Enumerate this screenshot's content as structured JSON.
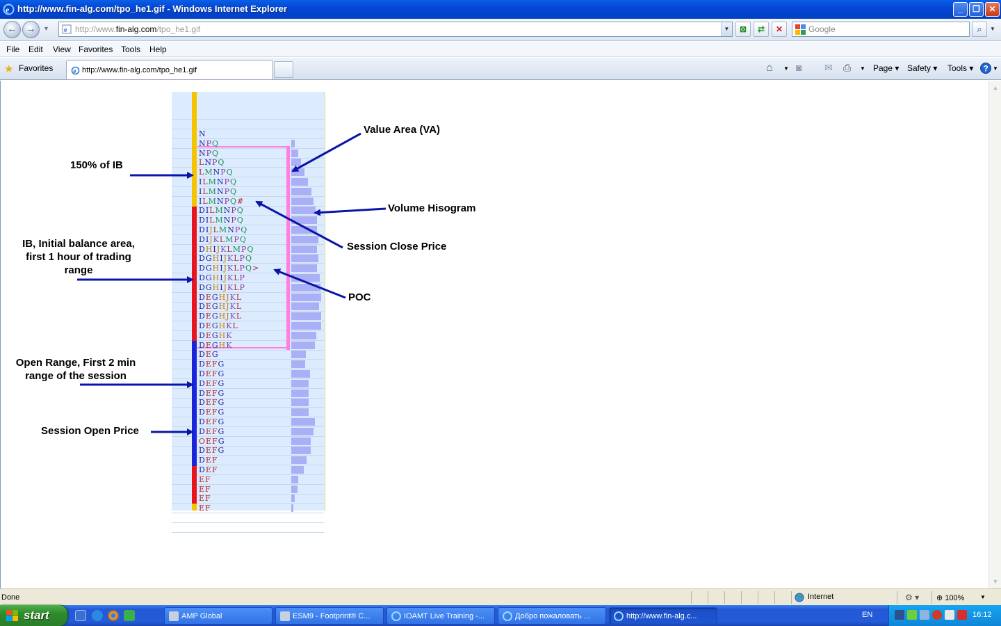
{
  "window": {
    "title": "http://www.fin-alg.com/tpo_he1.gif - Windows Internet Explorer"
  },
  "address": {
    "url_prefix": "http://www.",
    "url_domain": "fin-alg.com",
    "url_path": "/tpo_he1.gif",
    "search_placeholder": "Google"
  },
  "menu": [
    "File",
    "Edit",
    "View",
    "Favorites",
    "Tools",
    "Help"
  ],
  "favorites": {
    "label": "Favorites",
    "tab_label": "http://www.fin-alg.com/tpo_he1.gif"
  },
  "commandbar": {
    "page": "Page",
    "safety": "Safety",
    "tools": "Tools"
  },
  "chart": {
    "tpo_rows": [
      "N",
      "NPQ",
      "NPQ",
      "LNPQ",
      "LMNPQ",
      "ILMNPQ",
      "ILMNPQ",
      "ILMNPQ#",
      "DILMNPQ",
      "DILMNPQ",
      "DIJLMNPQ",
      "DIJKLMPQ",
      "DHIJKLMPQ",
      "DGHIJKLPQ",
      "DGHIJKLPQ>",
      "DGHIJKLP",
      "DGHIJKLP",
      "DEGHJKL",
      "DEGHJKL",
      "DEGHJKL",
      "DEGHKL",
      "DEGHK",
      "DEGHK",
      "DEG",
      "DEFG",
      "DEFG",
      "DEFG",
      "DEFG",
      "DEFG",
      "DEFG",
      "DEFG",
      "DEFG",
      "OEFG",
      "DEFG",
      "DEF",
      "DEF",
      "EF",
      "EF",
      "EF",
      "EF"
    ],
    "volume": [
      0,
      0.5,
      1.0,
      1.3,
      1.8,
      2.3,
      2.8,
      3.1,
      3.4,
      3.6,
      3.6,
      3.7,
      3.6,
      3.7,
      3.6,
      3.9,
      4.0,
      4.1,
      3.8,
      4.1,
      4.1,
      3.5,
      3.3,
      2.0,
      1.9,
      2.6,
      2.4,
      2.4,
      2.4,
      2.4,
      3.3,
      3.1,
      2.7,
      2.7,
      2.1,
      1.7,
      1.0,
      0.9,
      0.5,
      0.3
    ],
    "colors": {
      "bar_top": "#f5c400",
      "bar_ib": "#e8141e",
      "bar_open": "#1a25d8",
      "value_area": "#ff7ee0",
      "histogram": "#abaff6",
      "background": "#dcebfd",
      "arrow": "#0a14a8"
    }
  },
  "annotations": {
    "value_area": "Value Area (VA)",
    "ib150": "150% of IB",
    "volume_hist": "Volume Hisogram",
    "close_price": "Session Close Price",
    "ib_line1": "IB, Initial balance area,",
    "ib_line2": "first 1 hour of trading",
    "ib_line3": "range",
    "poc": "POC",
    "open_range_line1": "Open Range, First 2 min",
    "open_range_line2": "range of the session",
    "open_price": "Session Open Price"
  },
  "status": {
    "left": "Done",
    "zone": "Internet",
    "zoom": "100%"
  },
  "taskbar": {
    "start": "start",
    "tasks": [
      "AMP Global",
      "ESM9 - Footprint® C...",
      "IOAMT Live Training -...",
      "Добро пожаловать ...",
      "http://www.fin-alg.c..."
    ],
    "lang": "EN",
    "clock": "16:12"
  }
}
